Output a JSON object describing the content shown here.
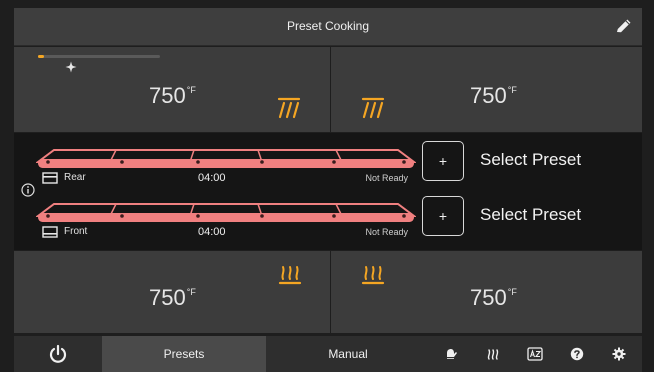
{
  "header": {
    "title": "Preset Cooking"
  },
  "zones": {
    "top_left": {
      "temp": "750",
      "unit": "°F"
    },
    "top_right": {
      "temp": "750",
      "unit": "°F"
    },
    "bottom_left": {
      "temp": "750",
      "unit": "°F"
    },
    "bottom_right": {
      "temp": "750",
      "unit": "°F"
    }
  },
  "progress": {
    "fraction": 0.05
  },
  "racks": [
    {
      "name": "Rear",
      "time": "04:00",
      "status": "Not Ready",
      "preset_label": "Select Preset",
      "add_label": "+"
    },
    {
      "name": "Front",
      "time": "04:00",
      "status": "Not Ready",
      "preset_label": "Select Preset",
      "add_label": "+"
    }
  ],
  "nav": {
    "presets_label": "Presets",
    "manual_label": "Manual",
    "active": "Presets",
    "icons": [
      "power-icon",
      "oven-mitt-icon",
      "steam-icon",
      "language-icon",
      "help-icon",
      "settings-icon"
    ]
  },
  "colors": {
    "accent": "#f5a623",
    "heater_bar": "#f08080",
    "panel": "#3c3c3c",
    "band": "#151515",
    "nav_active": "#4a4a4a"
  }
}
